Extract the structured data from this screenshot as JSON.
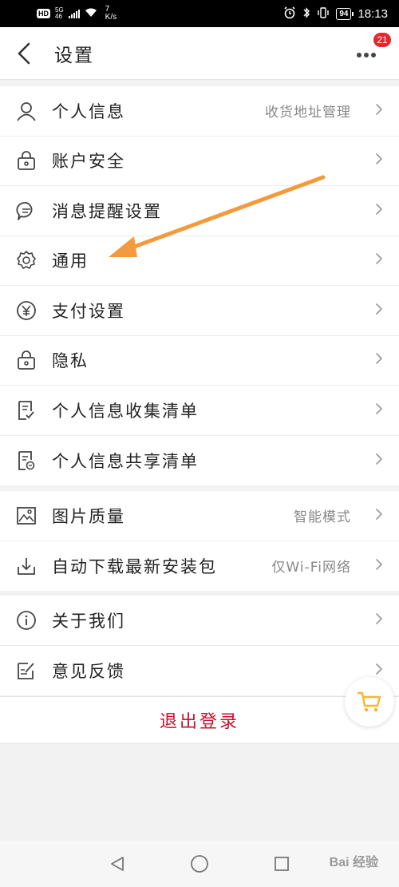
{
  "status_bar": {
    "hd": "HD",
    "network_top": "5G",
    "network_bottom": "46",
    "speed_value": "7",
    "speed_unit": "K/s",
    "battery": "94",
    "time": "18:13"
  },
  "header": {
    "title": "设置",
    "badge_count": "21"
  },
  "groups": [
    {
      "items": [
        {
          "label": "个人信息",
          "value": "收货地址管理",
          "icon": "user-icon"
        },
        {
          "label": "账户安全",
          "value": "",
          "icon": "lock-icon"
        },
        {
          "label": "消息提醒设置",
          "value": "",
          "icon": "chat-bubble-icon"
        },
        {
          "label": "通用",
          "value": "",
          "icon": "gear-icon"
        },
        {
          "label": "支付设置",
          "value": "",
          "icon": "yen-icon"
        },
        {
          "label": "隐私",
          "value": "",
          "icon": "lock-icon"
        },
        {
          "label": "个人信息收集清单",
          "value": "",
          "icon": "checklist-icon"
        },
        {
          "label": "个人信息共享清单",
          "value": "",
          "icon": "share-list-icon"
        }
      ]
    },
    {
      "items": [
        {
          "label": "图片质量",
          "value": "智能模式",
          "icon": "image-icon"
        },
        {
          "label": "自动下载最新安装包",
          "value": "仅Wi-Fi网络",
          "icon": "download-icon"
        }
      ]
    },
    {
      "items": [
        {
          "label": "关于我们",
          "value": "",
          "icon": "info-icon"
        },
        {
          "label": "意见反馈",
          "value": "",
          "icon": "feedback-icon"
        }
      ]
    }
  ],
  "logout": {
    "label": "退出登录"
  },
  "watermark": "Bai 经验",
  "colors": {
    "accent_red": "#c8102e",
    "badge_red": "#e4262d",
    "annotation_orange": "#f39a3c",
    "cart_yellow": "#f5b82e"
  }
}
